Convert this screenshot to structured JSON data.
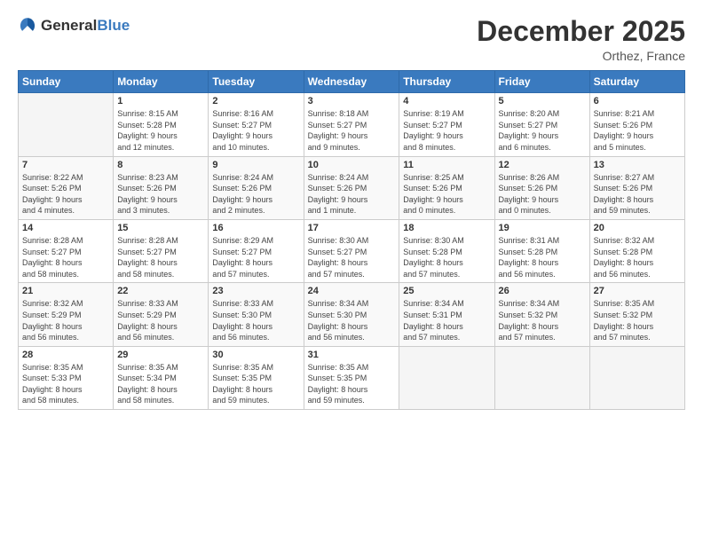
{
  "logo": {
    "general": "General",
    "blue": "Blue"
  },
  "header": {
    "month": "December 2025",
    "location": "Orthez, France"
  },
  "weekdays": [
    "Sunday",
    "Monday",
    "Tuesday",
    "Wednesday",
    "Thursday",
    "Friday",
    "Saturday"
  ],
  "weeks": [
    [
      {
        "day": "",
        "info": ""
      },
      {
        "day": "1",
        "info": "Sunrise: 8:15 AM\nSunset: 5:28 PM\nDaylight: 9 hours\nand 12 minutes."
      },
      {
        "day": "2",
        "info": "Sunrise: 8:16 AM\nSunset: 5:27 PM\nDaylight: 9 hours\nand 10 minutes."
      },
      {
        "day": "3",
        "info": "Sunrise: 8:18 AM\nSunset: 5:27 PM\nDaylight: 9 hours\nand 9 minutes."
      },
      {
        "day": "4",
        "info": "Sunrise: 8:19 AM\nSunset: 5:27 PM\nDaylight: 9 hours\nand 8 minutes."
      },
      {
        "day": "5",
        "info": "Sunrise: 8:20 AM\nSunset: 5:27 PM\nDaylight: 9 hours\nand 6 minutes."
      },
      {
        "day": "6",
        "info": "Sunrise: 8:21 AM\nSunset: 5:26 PM\nDaylight: 9 hours\nand 5 minutes."
      }
    ],
    [
      {
        "day": "7",
        "info": "Sunrise: 8:22 AM\nSunset: 5:26 PM\nDaylight: 9 hours\nand 4 minutes."
      },
      {
        "day": "8",
        "info": "Sunrise: 8:23 AM\nSunset: 5:26 PM\nDaylight: 9 hours\nand 3 minutes."
      },
      {
        "day": "9",
        "info": "Sunrise: 8:24 AM\nSunset: 5:26 PM\nDaylight: 9 hours\nand 2 minutes."
      },
      {
        "day": "10",
        "info": "Sunrise: 8:24 AM\nSunset: 5:26 PM\nDaylight: 9 hours\nand 1 minute."
      },
      {
        "day": "11",
        "info": "Sunrise: 8:25 AM\nSunset: 5:26 PM\nDaylight: 9 hours\nand 0 minutes."
      },
      {
        "day": "12",
        "info": "Sunrise: 8:26 AM\nSunset: 5:26 PM\nDaylight: 9 hours\nand 0 minutes."
      },
      {
        "day": "13",
        "info": "Sunrise: 8:27 AM\nSunset: 5:26 PM\nDaylight: 8 hours\nand 59 minutes."
      }
    ],
    [
      {
        "day": "14",
        "info": "Sunrise: 8:28 AM\nSunset: 5:27 PM\nDaylight: 8 hours\nand 58 minutes."
      },
      {
        "day": "15",
        "info": "Sunrise: 8:28 AM\nSunset: 5:27 PM\nDaylight: 8 hours\nand 58 minutes."
      },
      {
        "day": "16",
        "info": "Sunrise: 8:29 AM\nSunset: 5:27 PM\nDaylight: 8 hours\nand 57 minutes."
      },
      {
        "day": "17",
        "info": "Sunrise: 8:30 AM\nSunset: 5:27 PM\nDaylight: 8 hours\nand 57 minutes."
      },
      {
        "day": "18",
        "info": "Sunrise: 8:30 AM\nSunset: 5:28 PM\nDaylight: 8 hours\nand 57 minutes."
      },
      {
        "day": "19",
        "info": "Sunrise: 8:31 AM\nSunset: 5:28 PM\nDaylight: 8 hours\nand 56 minutes."
      },
      {
        "day": "20",
        "info": "Sunrise: 8:32 AM\nSunset: 5:28 PM\nDaylight: 8 hours\nand 56 minutes."
      }
    ],
    [
      {
        "day": "21",
        "info": "Sunrise: 8:32 AM\nSunset: 5:29 PM\nDaylight: 8 hours\nand 56 minutes."
      },
      {
        "day": "22",
        "info": "Sunrise: 8:33 AM\nSunset: 5:29 PM\nDaylight: 8 hours\nand 56 minutes."
      },
      {
        "day": "23",
        "info": "Sunrise: 8:33 AM\nSunset: 5:30 PM\nDaylight: 8 hours\nand 56 minutes."
      },
      {
        "day": "24",
        "info": "Sunrise: 8:34 AM\nSunset: 5:30 PM\nDaylight: 8 hours\nand 56 minutes."
      },
      {
        "day": "25",
        "info": "Sunrise: 8:34 AM\nSunset: 5:31 PM\nDaylight: 8 hours\nand 57 minutes."
      },
      {
        "day": "26",
        "info": "Sunrise: 8:34 AM\nSunset: 5:32 PM\nDaylight: 8 hours\nand 57 minutes."
      },
      {
        "day": "27",
        "info": "Sunrise: 8:35 AM\nSunset: 5:32 PM\nDaylight: 8 hours\nand 57 minutes."
      }
    ],
    [
      {
        "day": "28",
        "info": "Sunrise: 8:35 AM\nSunset: 5:33 PM\nDaylight: 8 hours\nand 58 minutes."
      },
      {
        "day": "29",
        "info": "Sunrise: 8:35 AM\nSunset: 5:34 PM\nDaylight: 8 hours\nand 58 minutes."
      },
      {
        "day": "30",
        "info": "Sunrise: 8:35 AM\nSunset: 5:35 PM\nDaylight: 8 hours\nand 59 minutes."
      },
      {
        "day": "31",
        "info": "Sunrise: 8:35 AM\nSunset: 5:35 PM\nDaylight: 8 hours\nand 59 minutes."
      },
      {
        "day": "",
        "info": ""
      },
      {
        "day": "",
        "info": ""
      },
      {
        "day": "",
        "info": ""
      }
    ]
  ]
}
